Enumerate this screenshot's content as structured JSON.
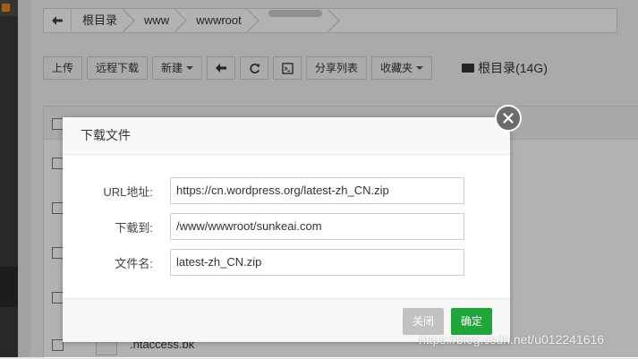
{
  "breadcrumb": {
    "items": [
      "根目录",
      "www",
      "wwwroot"
    ]
  },
  "toolbar": {
    "upload": "上传",
    "remote_download": "远程下载",
    "new": "新建",
    "share_list": "分享列表",
    "favorites": "收藏夹",
    "disk_label": "根目录(14G)"
  },
  "table": {
    "partial_row": ".ntaccess.bk"
  },
  "dialog": {
    "title": "下载文件",
    "url_label": "URL地址:",
    "url_value": "https://cn.wordpress.org/latest-zh_CN.zip",
    "path_label": "下载到:",
    "path_value": "/www/wwwroot/sunkeai.com",
    "filename_label": "文件名:",
    "filename_value": "latest-zh_CN.zip",
    "cancel": "关闭",
    "confirm": "确定"
  },
  "watermark": "https://blog.csdn.net/u012241616",
  "colors": {
    "confirm": "#20a53a",
    "cancel": "#c2c2c2",
    "close_circle": "#6b6b6b"
  }
}
